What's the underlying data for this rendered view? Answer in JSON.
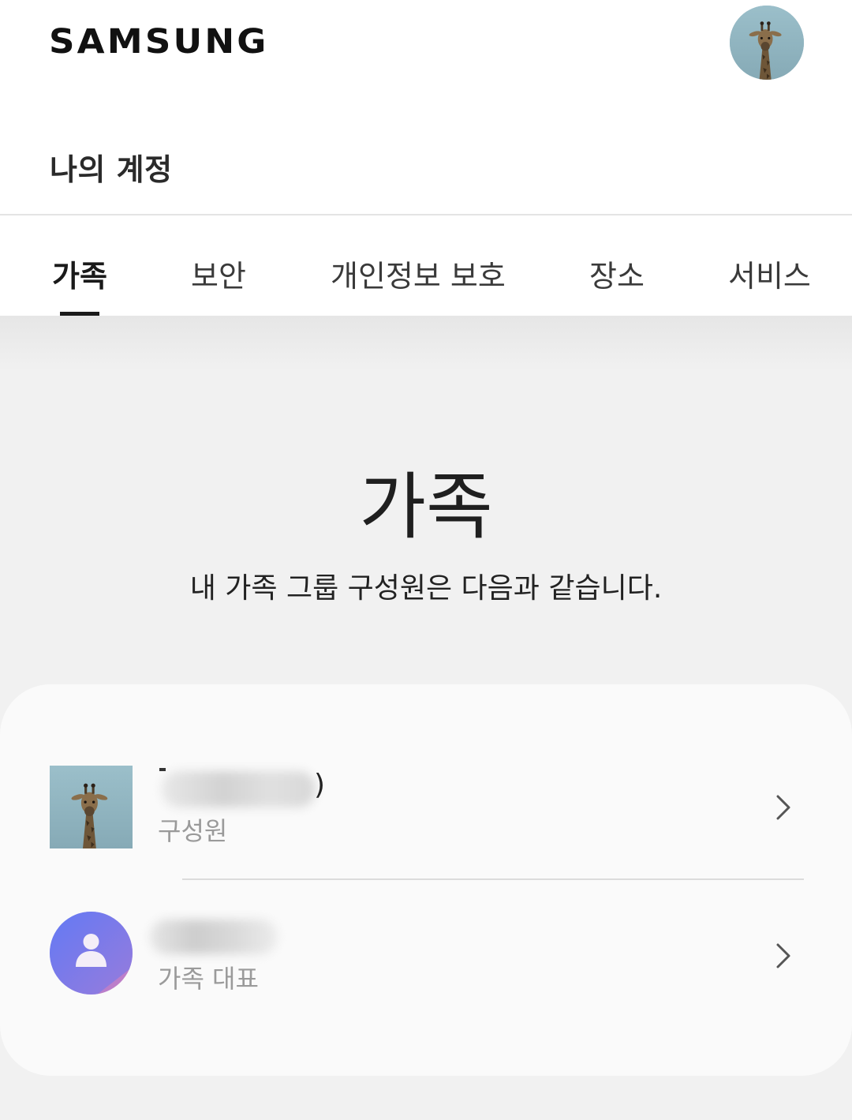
{
  "header": {
    "brand": "SAMSUNG",
    "page_title": "나의 계정"
  },
  "tabs": [
    {
      "label": "가족",
      "active": true
    },
    {
      "label": "보안",
      "active": false
    },
    {
      "label": "개인정보 보호",
      "active": false
    },
    {
      "label": "장소",
      "active": false
    },
    {
      "label": "서비스",
      "active": false
    }
  ],
  "hero": {
    "title": "가족",
    "subtitle": "내 가족 그룹 구성원은 다음과 같습니다."
  },
  "members": [
    {
      "name_visible_end": ")",
      "role": "구성원",
      "avatar": "giraffe-photo",
      "chevron": "chevron-right-icon"
    },
    {
      "name_visible_end": "",
      "role": "가족 대표",
      "avatar": "person-icon",
      "chevron": "chevron-right-icon"
    }
  ],
  "colors": {
    "background": "#f1f1f1",
    "card": "#fafafa",
    "text_primary": "#1f1f1f",
    "text_secondary": "#9a9a9a",
    "avatar_gradient_start": "#5b7cf7",
    "avatar_gradient_end": "#d07fc0"
  }
}
